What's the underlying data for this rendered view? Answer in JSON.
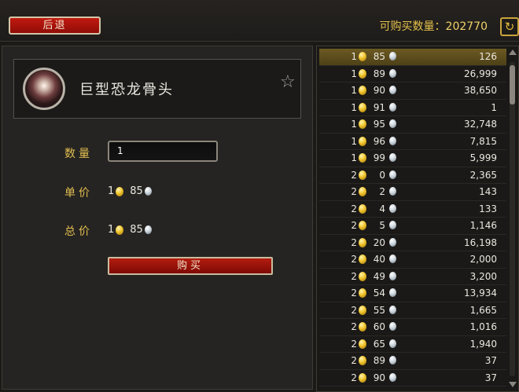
{
  "header": {
    "back_label": "后退",
    "available_label": "可购买数量：",
    "available_count": "202770",
    "refresh_icon": "refresh-icon"
  },
  "item": {
    "name": "巨型恐龙骨头",
    "icon": "bone-item-icon",
    "favorite_icon": "star-icon"
  },
  "form": {
    "quantity_label": "数量",
    "quantity_value": "1",
    "unit_price_label": "单价",
    "unit_gold": "1",
    "unit_silver": "85",
    "total_label": "总价",
    "total_gold": "1",
    "total_silver": "85",
    "buy_label": "购买"
  },
  "colors": {
    "accent_gold": "#e2bf4f",
    "button_red": "#b31c10",
    "selected_row": "#6c5a22"
  },
  "listings": [
    {
      "gold": "1",
      "silver": "85",
      "quantity": "126",
      "selected": true
    },
    {
      "gold": "1",
      "silver": "89",
      "quantity": "26,999"
    },
    {
      "gold": "1",
      "silver": "90",
      "quantity": "38,650"
    },
    {
      "gold": "1",
      "silver": "91",
      "quantity": "1"
    },
    {
      "gold": "1",
      "silver": "95",
      "quantity": "32,748"
    },
    {
      "gold": "1",
      "silver": "96",
      "quantity": "7,815"
    },
    {
      "gold": "1",
      "silver": "99",
      "quantity": "5,999"
    },
    {
      "gold": "2",
      "silver": "0",
      "quantity": "2,365"
    },
    {
      "gold": "2",
      "silver": "2",
      "quantity": "143"
    },
    {
      "gold": "2",
      "silver": "4",
      "quantity": "133"
    },
    {
      "gold": "2",
      "silver": "5",
      "quantity": "1,146"
    },
    {
      "gold": "2",
      "silver": "20",
      "quantity": "16,198"
    },
    {
      "gold": "2",
      "silver": "40",
      "quantity": "2,000"
    },
    {
      "gold": "2",
      "silver": "49",
      "quantity": "3,200"
    },
    {
      "gold": "2",
      "silver": "54",
      "quantity": "13,934"
    },
    {
      "gold": "2",
      "silver": "55",
      "quantity": "1,665"
    },
    {
      "gold": "2",
      "silver": "60",
      "quantity": "1,016"
    },
    {
      "gold": "2",
      "silver": "65",
      "quantity": "1,940"
    },
    {
      "gold": "2",
      "silver": "89",
      "quantity": "37"
    },
    {
      "gold": "2",
      "silver": "90",
      "quantity": "37"
    }
  ]
}
